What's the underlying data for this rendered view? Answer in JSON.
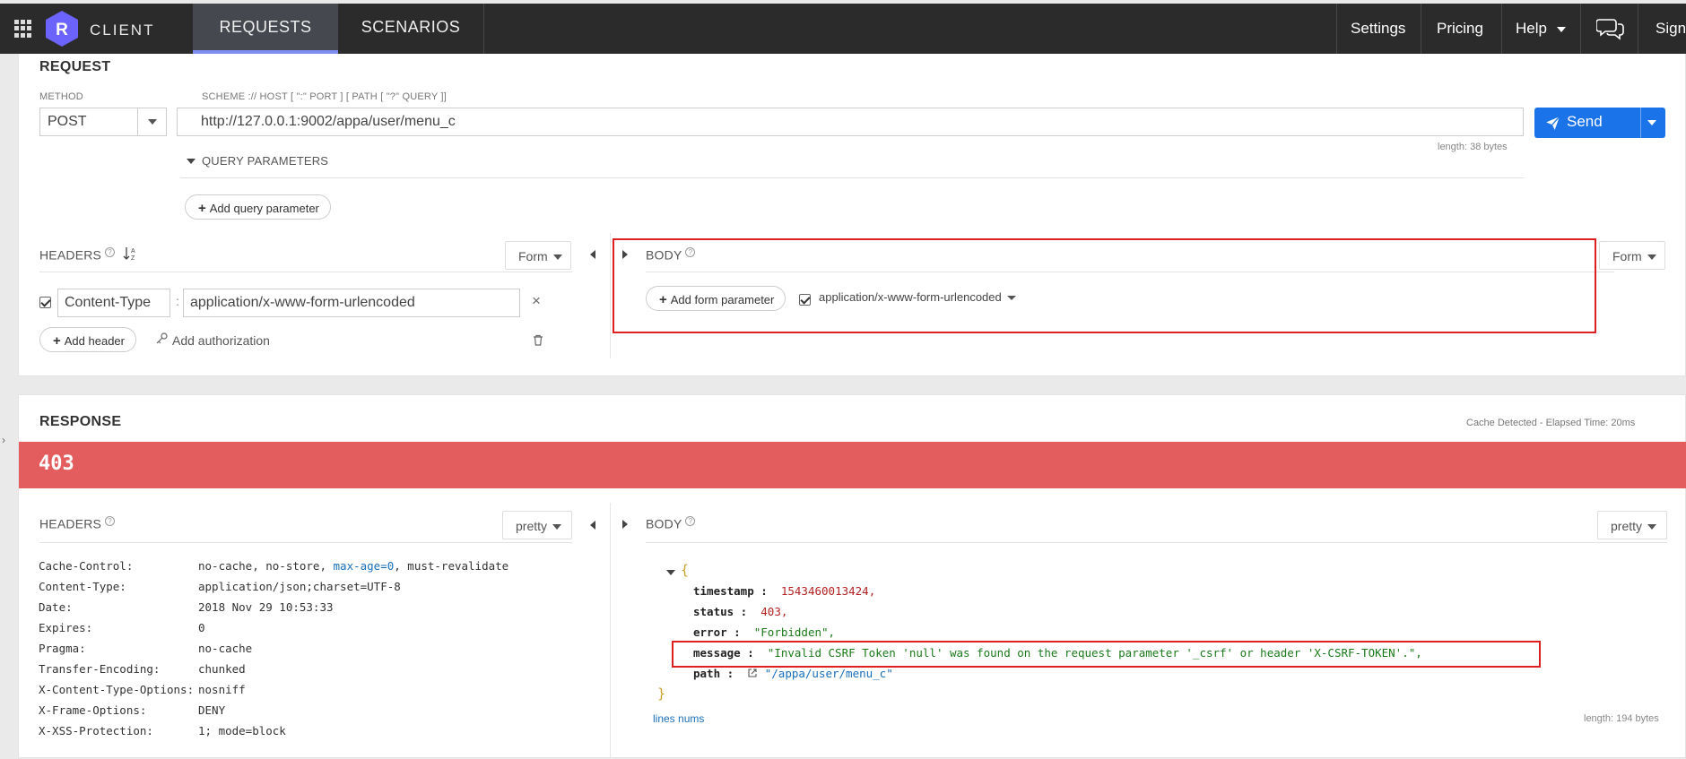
{
  "topbar": {
    "brand_initial": "R",
    "brand": "CLIENT",
    "tabs": [
      "REQUESTS",
      "SCENARIOS"
    ],
    "settings": "Settings",
    "pricing": "Pricing",
    "help": "Help",
    "sign": "Sign"
  },
  "request": {
    "title": "REQUEST",
    "method_label": "METHOD",
    "method": "POST",
    "url_hint": "SCHEME :// HOST [ \":\" PORT ] [ PATH [ \"?\" QUERY ]]",
    "url": "http://127.0.0.1:9002/appa/user/menu_c",
    "send_label": "Send",
    "length": "length: 38 bytes",
    "query_params_label": "QUERY PARAMETERS",
    "add_query_param": "Add query parameter",
    "headers_label": "HEADERS",
    "headers_format": "Form",
    "header_name": "Content-Type",
    "header_value": "application/x-www-form-urlencoded",
    "add_header": "Add header",
    "add_authorization": "Add authorization",
    "body_label": "BODY",
    "body_format": "Form",
    "add_form_param": "Add form parameter",
    "content_type": "application/x-www-form-urlencoded"
  },
  "response": {
    "title": "RESPONSE",
    "cache_info": "Cache Detected - Elapsed Time: 20ms",
    "status_code": "403",
    "headers_label": "HEADERS",
    "headers_format": "pretty",
    "body_label": "BODY",
    "body_format": "pretty",
    "headers": [
      {
        "name": "Cache-Control:",
        "value_pre": "no-cache, no-store, ",
        "value_hl": "max-age=0",
        "value_post": ", must-revalidate"
      },
      {
        "name": "Content-Type:",
        "value_pre": "application/json;charset=UTF-8",
        "value_hl": "",
        "value_post": ""
      },
      {
        "name": "Date:",
        "value_pre": "2018 Nov 29 10:53:33",
        "value_hl": "",
        "value_post": ""
      },
      {
        "name": "Expires:",
        "value_pre": "0",
        "value_hl": "",
        "value_post": ""
      },
      {
        "name": "Pragma:",
        "value_pre": "no-cache",
        "value_hl": "",
        "value_post": ""
      },
      {
        "name": "Transfer-Encoding:",
        "value_pre": "chunked",
        "value_hl": "",
        "value_post": ""
      },
      {
        "name": "X-Content-Type-Options:",
        "value_pre": "nosniff",
        "value_hl": "",
        "value_post": ""
      },
      {
        "name": "X-Frame-Options:",
        "value_pre": "DENY",
        "value_hl": "",
        "value_post": ""
      },
      {
        "name": "X-XSS-Protection:",
        "value_pre": "1; mode=block",
        "value_hl": "",
        "value_post": ""
      }
    ],
    "json_open": "{",
    "json_close": "}",
    "json": {
      "timestamp_key": "timestamp :",
      "timestamp": "1543460013424,",
      "status_key": "status :",
      "status": "403,",
      "error_key": "error :",
      "error": "\"Forbidden\",",
      "message_key": "message :",
      "message": "\"Invalid CSRF Token 'null' was found on the request parameter '_csrf' or header 'X-CSRF-TOKEN'.\",",
      "path_key": "path :",
      "path": "\"/appa/user/menu_c\""
    },
    "lines_nums": "lines nums",
    "length": "length: 194 bytes"
  },
  "colors": {
    "topbar": "#2b2b2b",
    "accent": "#1a73e8",
    "status_error": "#e35d5f",
    "highlight_box": "#e02020"
  }
}
